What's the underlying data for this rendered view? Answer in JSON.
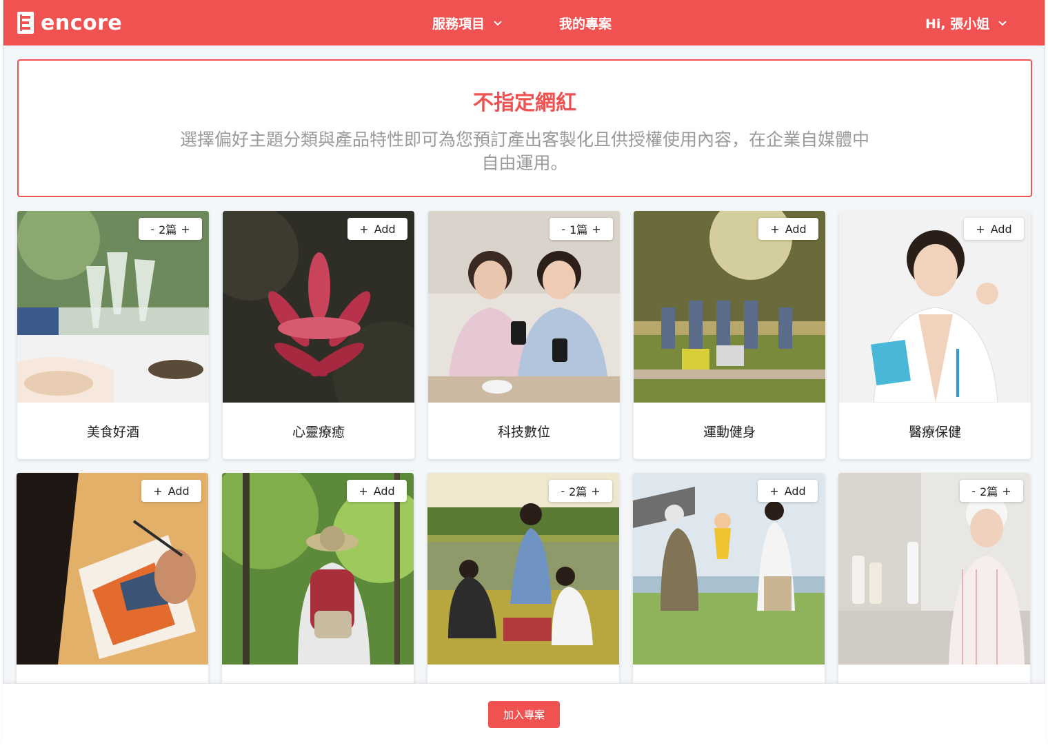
{
  "header": {
    "logo_text": "encore",
    "nav": {
      "services": "服務項目",
      "projects": "我的專案",
      "user": "Hi, 張小姐"
    }
  },
  "banner": {
    "title": "不指定網紅",
    "description": "選擇偏好主題分類與產品特性即可為您預訂產出客製化且供授權使用內容，在企業自媒體中自由運用。"
  },
  "cards": [
    {
      "label": "美食好酒",
      "state": "qty",
      "count": "2篇",
      "minus": "-",
      "plus": "+"
    },
    {
      "label": "心靈療癒",
      "state": "add",
      "add_text": "Add",
      "plus": "+"
    },
    {
      "label": "科技數位",
      "state": "qty",
      "count": "1篇",
      "minus": "-",
      "plus": "+"
    },
    {
      "label": "運動健身",
      "state": "add",
      "add_text": "Add",
      "plus": "+"
    },
    {
      "label": "醫療保健",
      "state": "add",
      "add_text": "Add",
      "plus": "+"
    },
    {
      "label": "",
      "state": "add",
      "add_text": "Add",
      "plus": "+"
    },
    {
      "label": "",
      "state": "add",
      "add_text": "Add",
      "plus": "+"
    },
    {
      "label": "",
      "state": "qty",
      "count": "2篇",
      "minus": "-",
      "plus": "+"
    },
    {
      "label": "",
      "state": "add",
      "add_text": "Add",
      "plus": "+"
    },
    {
      "label": "",
      "state": "qty",
      "count": "2篇",
      "minus": "-",
      "plus": "+"
    }
  ],
  "footer": {
    "join_label": "加入專案"
  },
  "colors": {
    "brand": "#f05151",
    "background": "#f4f7fa"
  }
}
